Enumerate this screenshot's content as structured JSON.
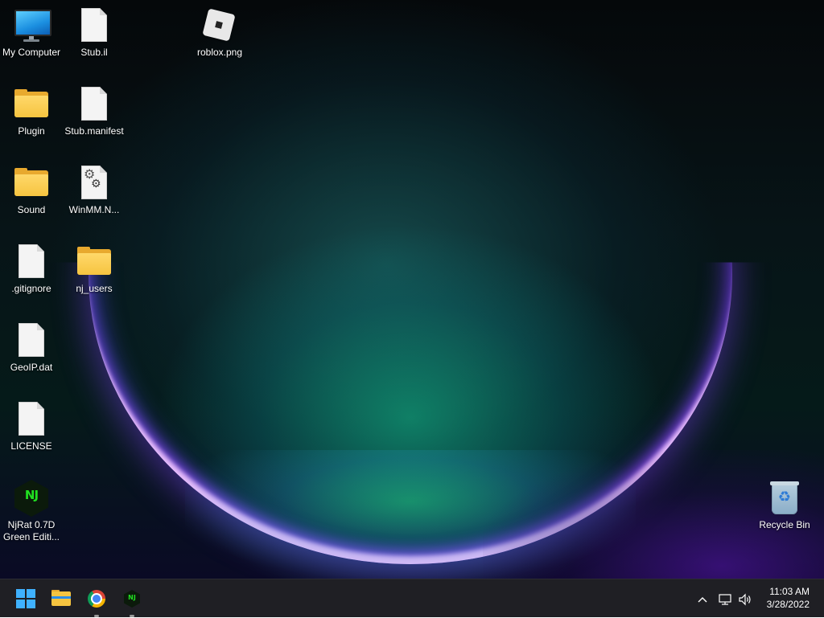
{
  "desktop": {
    "icons": [
      {
        "label": "My Computer",
        "type": "computer"
      },
      {
        "label": "Stub.il",
        "type": "file"
      },
      {
        "label": "roblox.png",
        "type": "roblox-image"
      },
      {
        "label": "Plugin",
        "type": "folder"
      },
      {
        "label": "Stub.manifest",
        "type": "file"
      },
      {
        "label": "Sound",
        "type": "folder"
      },
      {
        "label": "WinMM.N...",
        "type": "settings-file"
      },
      {
        "label": ".gitignore",
        "type": "file"
      },
      {
        "label": "nj_users",
        "type": "folder"
      },
      {
        "label": "GeoIP.dat",
        "type": "file"
      },
      {
        "label": "LICENSE",
        "type": "file"
      },
      {
        "label": "NjRat 0.7D Green Editi...",
        "type": "njrat-app"
      },
      {
        "label": "Recycle Bin",
        "type": "recycle-bin"
      }
    ]
  },
  "taskbar": {
    "pinned": [
      {
        "name": "start",
        "icon": "windows-logo-icon"
      },
      {
        "name": "file-explorer",
        "icon": "folder-icon"
      },
      {
        "name": "chrome",
        "icon": "chrome-icon",
        "running": true
      },
      {
        "name": "njrat",
        "icon": "njrat-icon",
        "running": true
      }
    ],
    "tray": {
      "icons": [
        "chevron-up-icon",
        "network-icon",
        "volume-icon"
      ]
    },
    "clock": {
      "time": "11:03 AM",
      "date": "3/28/2022"
    }
  },
  "theme": {
    "accent": "#3fb1ff",
    "taskbar_bg": "#1f1f24",
    "njrat_green": "#21e021"
  }
}
